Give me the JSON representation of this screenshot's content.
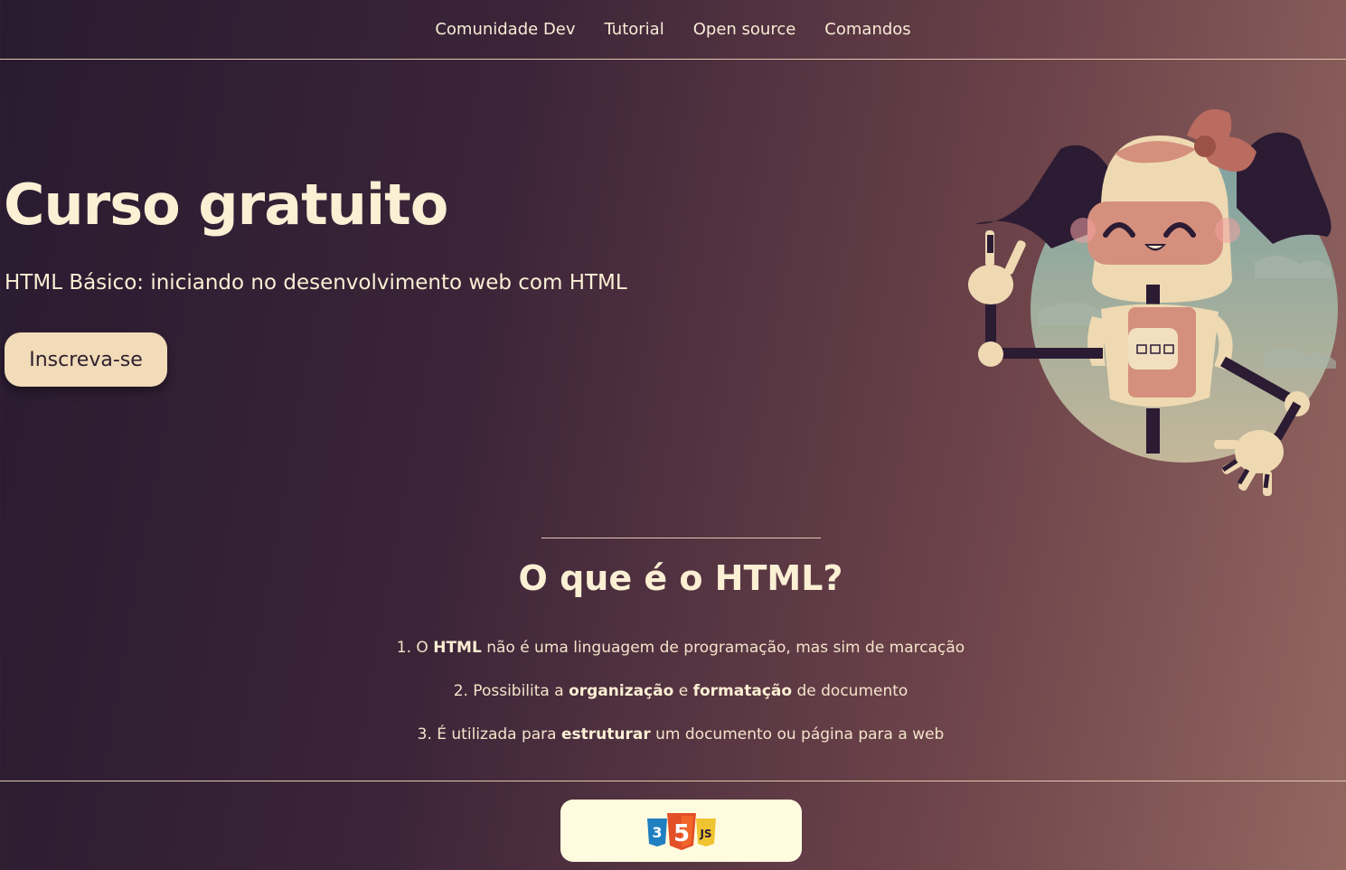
{
  "nav": {
    "items": [
      "Comunidade Dev",
      "Tutorial",
      "Open source",
      "Comandos"
    ]
  },
  "hero": {
    "title": "Curso gratuito",
    "subtitle": "HTML Básico: iniciando no desenvolvimento web com HTML",
    "cta_label": "Inscreva-se",
    "illustration": "robot-girl-illustration"
  },
  "section": {
    "title": "O que é o HTML?",
    "facts": [
      {
        "prefix": "1. O ",
        "b1": "HTML",
        "mid": " não é uma linguagem de programação, mas sim de marcação",
        "b2": "",
        "suffix": ""
      },
      {
        "prefix": "2. Possibilita a ",
        "b1": "organização",
        "mid": " e ",
        "b2": "formatação",
        "suffix": " de documento"
      },
      {
        "prefix": "3. É utilizada para ",
        "b1": "estruturar",
        "mid": " um documento ou página para a web",
        "b2": "",
        "suffix": ""
      }
    ]
  },
  "footer": {
    "logo": "css3-html5-js-logo",
    "logo_text": {
      "left": "3",
      "center": "5",
      "right": "JS"
    }
  },
  "colors": {
    "background_dark": "#281b30",
    "background_light": "#946761",
    "text_cream": "#fbefd4",
    "button_bg": "#f1dbb8",
    "footer_card": "#fffbdf",
    "html5_orange": "#e34f26",
    "css3_blue": "#1f7fc1",
    "js_yellow": "#f0c431"
  }
}
